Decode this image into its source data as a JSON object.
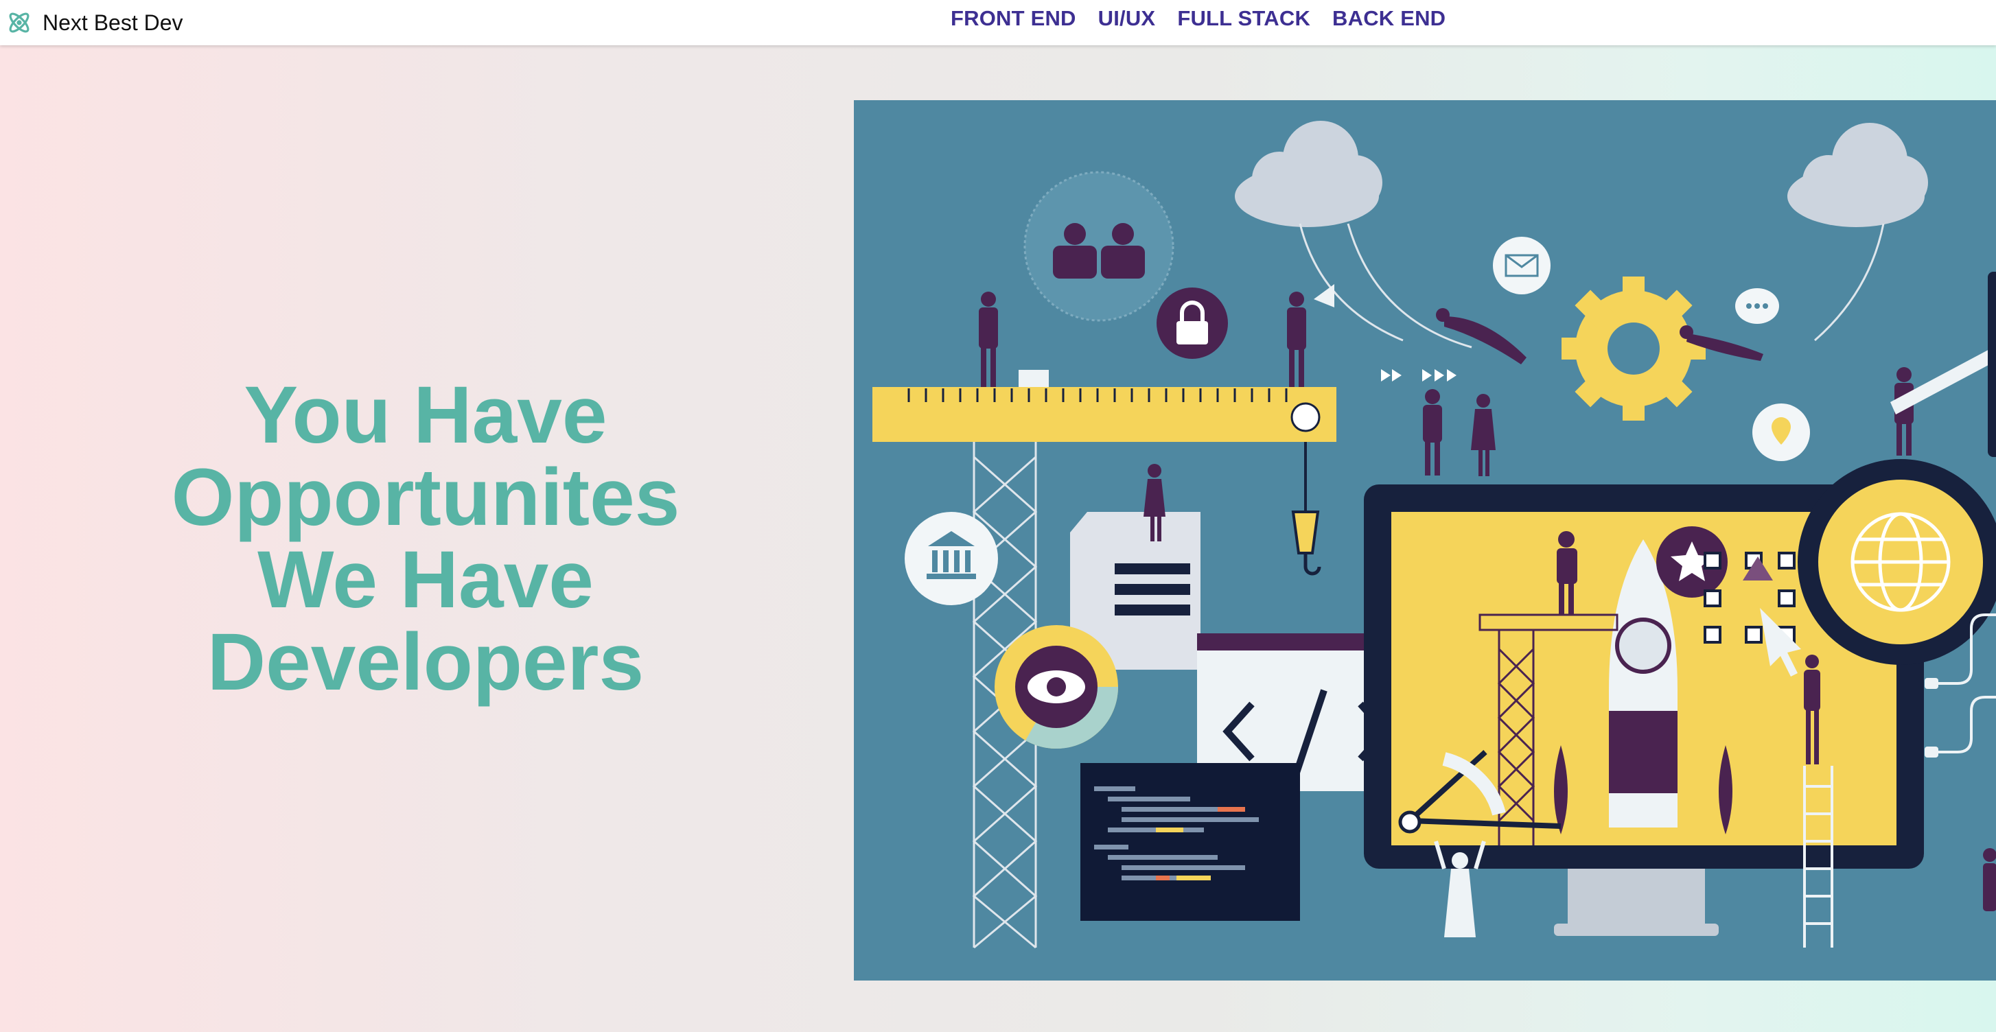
{
  "brand": {
    "name": "Next Best Dev",
    "icon": "atom-logo-icon",
    "color": "#58b4a5"
  },
  "nav": {
    "links": [
      {
        "label": "FRONT END"
      },
      {
        "label": "UI/UX"
      },
      {
        "label": "FULL STACK"
      },
      {
        "label": "BACK END"
      }
    ],
    "color": "#3d2f92"
  },
  "hero": {
    "lines": [
      "You Have",
      "Opportunites",
      "We Have",
      "Developers"
    ],
    "color": "#58b4a5"
  },
  "illustration": {
    "name": "developer-workspace-illustration",
    "colors": {
      "background": "#4f88a1",
      "yellow": "#f5d45a",
      "navy": "#17213d",
      "purple": "#4a2350"
    }
  }
}
